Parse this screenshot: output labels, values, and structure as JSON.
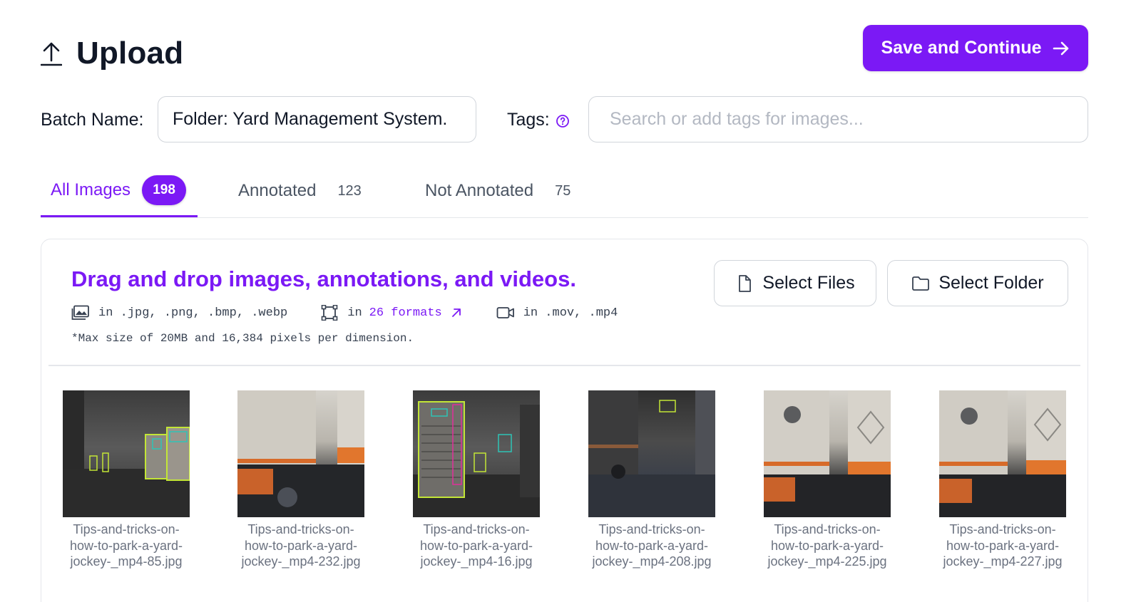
{
  "header": {
    "title": "Upload",
    "icon": "upload-icon",
    "save_button": "Save and Continue"
  },
  "form": {
    "batch_label": "Batch Name:",
    "batch_value": "Folder: Yard Management System.",
    "tags_label": "Tags:",
    "tags_placeholder": "Search or add tags for images..."
  },
  "tabs": [
    {
      "label": "All Images",
      "count": "198",
      "active": true
    },
    {
      "label": "Annotated",
      "count": "123",
      "active": false
    },
    {
      "label": "Not Annotated",
      "count": "75",
      "active": false
    }
  ],
  "dropzone": {
    "title": "Drag and drop images, annotations, and videos.",
    "images_formats": "in .jpg, .png, .bmp, .webp",
    "annotations_prefix": "in",
    "annotations_link": "26 formats",
    "videos_formats": "in .mov, .mp4",
    "note": "*Max size of 20MB and 16,384 pixels per dimension.",
    "select_files": "Select Files",
    "select_folder": "Select Folder"
  },
  "thumbnails": [
    {
      "line1": "Tips-and-tricks-on-",
      "line2": "how-to-park-a-yard-",
      "line3": "jockey-_mp4-85.jpg"
    },
    {
      "line1": "Tips-and-tricks-on-",
      "line2": "how-to-park-a-yard-",
      "line3": "jockey-_mp4-232.jpg"
    },
    {
      "line1": "Tips-and-tricks-on-",
      "line2": "how-to-park-a-yard-",
      "line3": "jockey-_mp4-16.jpg"
    },
    {
      "line1": "Tips-and-tricks-on-",
      "line2": "how-to-park-a-yard-",
      "line3": "jockey-_mp4-208.jpg"
    },
    {
      "line1": "Tips-and-tricks-on-",
      "line2": "how-to-park-a-yard-",
      "line3": "jockey-_mp4-225.jpg"
    },
    {
      "line1": "Tips-and-tricks-on-",
      "line2": "how-to-park-a-yard-",
      "line3": "jockey-_mp4-227.jpg"
    }
  ],
  "colors": {
    "accent": "#7b19f5",
    "border": "#d1d5db",
    "muted_text": "#6b7280"
  }
}
